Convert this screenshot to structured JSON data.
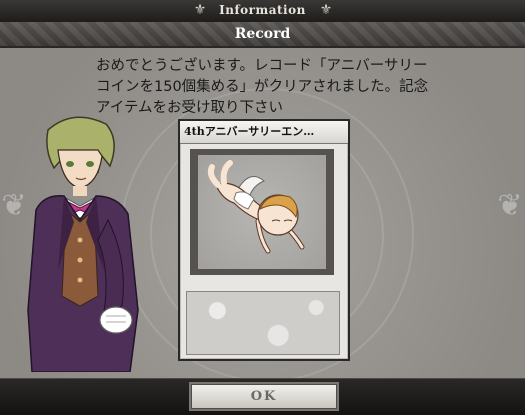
{
  "header": {
    "title": "Information",
    "ornament_left": "⚜",
    "ornament_right": "⚜"
  },
  "record": {
    "title": "Record"
  },
  "message": {
    "lines": [
      "おめでとうございます。レコード「アニバーサリー",
      "コインを150個集める」がクリアされました。記念",
      "アイテムをお受け取り下さい"
    ]
  },
  "card": {
    "title": "4thアニバーサリーエン…"
  },
  "footer": {
    "ok_label": "OK"
  },
  "colors": {
    "panel": "#9a9792",
    "header": "#1f1d1c",
    "accent_coat": "#4e2f57"
  },
  "icons": {
    "ornament": "fleur-ornament",
    "card_art": "flying-cherub-figure",
    "character": "purple-coat-man"
  }
}
